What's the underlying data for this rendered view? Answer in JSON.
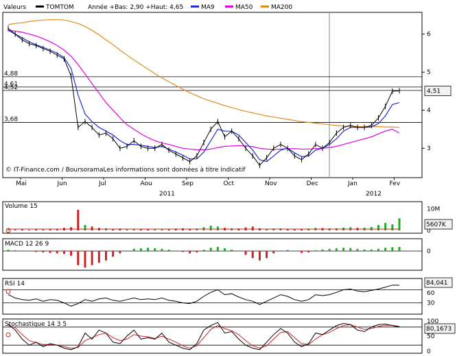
{
  "colors": {
    "background": "#ffffff",
    "axis": "#000000",
    "grid": "#c8c8c8",
    "price": "#000000",
    "ma9": "#1f2bd6",
    "ma50": "#e000e0",
    "ma200": "#e08a1a",
    "volume_up": "#22aa22",
    "volume_down": "#cc2222",
    "macd_pos": "#22aa22",
    "macd_neg": "#cc2222",
    "rsi": "#000000",
    "stoch_k": "#000000",
    "stoch_d": "#cc2222",
    "badge": "#f2f2f2"
  },
  "legend": {
    "valeurs": "Valeurs",
    "symbol": "TOMTOM",
    "range": "Année +Bas: 2,90 +Haut: 4,65",
    "ma9": "MA9",
    "ma50": "MA50",
    "ma200": "MA200"
  },
  "watermark": "© IT-Finance.com / BoursoramaLes informations sont données à titre indicatif",
  "x_axis": {
    "months": [
      "Mai",
      "Jun",
      "Jul",
      "Aou",
      "Sep",
      "Oct",
      "Nov",
      "Dec",
      "Jan",
      "Fev"
    ],
    "years": [
      "2011",
      "2012"
    ]
  },
  "price_panel": {
    "y_ticks": [
      "6",
      "5",
      "4",
      "3"
    ],
    "level_labels": [
      "4,88",
      "4,61",
      "4,52",
      "3,68"
    ],
    "last_value": "4,51"
  },
  "volume_panel": {
    "label": "Volume 15",
    "y_ticks": [
      "10M",
      "0"
    ],
    "last_value": "5607K"
  },
  "macd_panel": {
    "label": "MACD 12 26 9",
    "y_ticks": [
      "0"
    ]
  },
  "rsi_panel": {
    "label": "RSI 14",
    "y_ticks": [
      "60",
      "30"
    ],
    "last_value": "84,041"
  },
  "stoch_panel": {
    "label": "Stochastique 14 3 5",
    "y_ticks": [
      "100",
      "50",
      "0"
    ],
    "last_value": "80,1673"
  },
  "chart_data": {
    "type": "line",
    "title": "TOMTOM",
    "x_range": [
      "2011-05",
      "2012-02"
    ],
    "price": {
      "ylim": [
        2.3,
        6.5
      ],
      "series": [
        {
          "name": "TOMTOM",
          "values": [
            6.15,
            6.0,
            5.85,
            5.75,
            5.7,
            5.62,
            5.55,
            5.45,
            5.35,
            4.9,
            3.55,
            3.7,
            3.55,
            3.35,
            3.4,
            3.25,
            3.0,
            3.05,
            3.2,
            3.05,
            3.0,
            3.0,
            3.1,
            2.95,
            2.85,
            2.75,
            2.65,
            2.8,
            3.15,
            3.5,
            3.7,
            3.3,
            3.45,
            3.25,
            3.0,
            2.8,
            2.55,
            2.75,
            3.0,
            3.1,
            3.0,
            2.8,
            2.7,
            2.85,
            3.1,
            3.0,
            3.15,
            3.4,
            3.55,
            3.6,
            3.55,
            3.55,
            3.6,
            3.8,
            4.1,
            4.5,
            4.51
          ]
        },
        {
          "name": "MA9",
          "values": [
            6.1,
            6.0,
            5.9,
            5.8,
            5.72,
            5.65,
            5.58,
            5.5,
            5.38,
            5.1,
            4.4,
            3.9,
            3.7,
            3.55,
            3.45,
            3.35,
            3.2,
            3.1,
            3.1,
            3.08,
            3.05,
            3.02,
            3.05,
            2.98,
            2.9,
            2.82,
            2.72,
            2.72,
            2.9,
            3.2,
            3.5,
            3.45,
            3.45,
            3.35,
            3.15,
            2.95,
            2.7,
            2.65,
            2.8,
            2.95,
            3.0,
            2.88,
            2.78,
            2.8,
            2.95,
            3.0,
            3.1,
            3.25,
            3.45,
            3.55,
            3.55,
            3.55,
            3.56,
            3.65,
            3.85,
            4.15,
            4.2
          ]
        },
        {
          "name": "MA50",
          "values": [
            6.1,
            6.08,
            6.05,
            6.0,
            5.95,
            5.88,
            5.8,
            5.7,
            5.58,
            5.42,
            5.2,
            4.95,
            4.7,
            4.45,
            4.2,
            4.0,
            3.8,
            3.62,
            3.5,
            3.38,
            3.28,
            3.2,
            3.14,
            3.1,
            3.05,
            3.0,
            2.98,
            2.96,
            2.96,
            2.98,
            3.02,
            3.05,
            3.06,
            3.07,
            3.06,
            3.04,
            3.0,
            2.98,
            2.97,
            2.98,
            2.99,
            2.99,
            2.98,
            2.98,
            2.99,
            3.0,
            3.02,
            3.05,
            3.1,
            3.15,
            3.2,
            3.25,
            3.3,
            3.38,
            3.45,
            3.5,
            3.4
          ]
        },
        {
          "name": "MA200",
          "values": [
            6.25,
            6.28,
            6.3,
            6.33,
            6.35,
            6.37,
            6.38,
            6.38,
            6.37,
            6.33,
            6.28,
            6.2,
            6.1,
            5.98,
            5.85,
            5.72,
            5.58,
            5.45,
            5.32,
            5.2,
            5.08,
            4.96,
            4.85,
            4.75,
            4.65,
            4.55,
            4.46,
            4.38,
            4.3,
            4.24,
            4.18,
            4.12,
            4.07,
            4.02,
            3.97,
            3.93,
            3.89,
            3.85,
            3.82,
            3.79,
            3.76,
            3.73,
            3.7,
            3.68,
            3.66,
            3.64,
            3.62,
            3.6,
            3.58,
            3.58,
            3.57,
            3.57,
            3.57,
            3.57,
            3.56,
            3.56,
            3.55
          ]
        }
      ]
    },
    "volume": [
      0.5,
      0.4,
      0.6,
      0.3,
      0.5,
      0.4,
      0.6,
      0.8,
      1.2,
      1.5,
      9.5,
      2.5,
      1.8,
      1.2,
      1.0,
      0.8,
      0.9,
      0.7,
      0.8,
      0.6,
      0.7,
      0.5,
      0.6,
      0.7,
      0.9,
      1.0,
      0.8,
      0.9,
      1.5,
      2.2,
      1.8,
      1.2,
      1.0,
      0.9,
      1.4,
      1.8,
      1.0,
      0.8,
      0.9,
      1.0,
      0.8,
      0.7,
      0.8,
      0.9,
      1.2,
      1.1,
      1.0,
      1.0,
      1.3,
      1.5,
      1.2,
      1.3,
      1.6,
      2.5,
      3.5,
      2.8,
      5.6
    ],
    "macd": [
      0.05,
      0.03,
      0.02,
      0.0,
      -0.02,
      -0.03,
      -0.04,
      -0.05,
      -0.06,
      -0.1,
      -0.3,
      -0.35,
      -0.3,
      -0.25,
      -0.2,
      -0.12,
      -0.05,
      0.02,
      0.08,
      0.1,
      0.12,
      0.1,
      0.08,
      0.05,
      0.02,
      -0.02,
      -0.05,
      -0.03,
      0.05,
      0.12,
      0.15,
      0.1,
      0.05,
      0.0,
      -0.08,
      -0.15,
      -0.2,
      -0.15,
      -0.05,
      0.02,
      0.04,
      0.0,
      -0.04,
      -0.03,
      0.03,
      0.06,
      0.08,
      0.1,
      0.12,
      0.11,
      0.08,
      0.06,
      0.06,
      0.08,
      0.12,
      0.14,
      0.15
    ],
    "rsi": [
      55,
      45,
      40,
      38,
      42,
      35,
      40,
      38,
      30,
      20,
      28,
      40,
      35,
      42,
      45,
      38,
      35,
      40,
      45,
      40,
      42,
      40,
      45,
      38,
      35,
      30,
      28,
      35,
      50,
      62,
      70,
      55,
      58,
      48,
      40,
      35,
      25,
      35,
      45,
      55,
      50,
      40,
      35,
      40,
      55,
      52,
      55,
      62,
      70,
      72,
      66,
      64,
      68,
      72,
      78,
      84,
      84.041
    ],
    "stoch_k": [
      90,
      70,
      40,
      20,
      30,
      15,
      25,
      20,
      10,
      5,
      15,
      60,
      40,
      70,
      60,
      30,
      25,
      50,
      70,
      40,
      45,
      40,
      60,
      30,
      20,
      10,
      5,
      25,
      70,
      85,
      95,
      60,
      65,
      40,
      20,
      10,
      5,
      30,
      55,
      75,
      60,
      30,
      15,
      25,
      60,
      55,
      70,
      85,
      92,
      88,
      70,
      65,
      80,
      88,
      90,
      85,
      80.1673
    ],
    "stoch_d": [
      85,
      78,
      55,
      35,
      28,
      22,
      22,
      20,
      15,
      10,
      12,
      35,
      45,
      55,
      60,
      45,
      35,
      40,
      55,
      50,
      48,
      42,
      50,
      40,
      30,
      18,
      10,
      18,
      45,
      72,
      85,
      75,
      68,
      55,
      35,
      18,
      10,
      18,
      40,
      62,
      65,
      45,
      25,
      22,
      40,
      55,
      62,
      75,
      85,
      88,
      80,
      72,
      75,
      82,
      86,
      86,
      82
    ]
  }
}
